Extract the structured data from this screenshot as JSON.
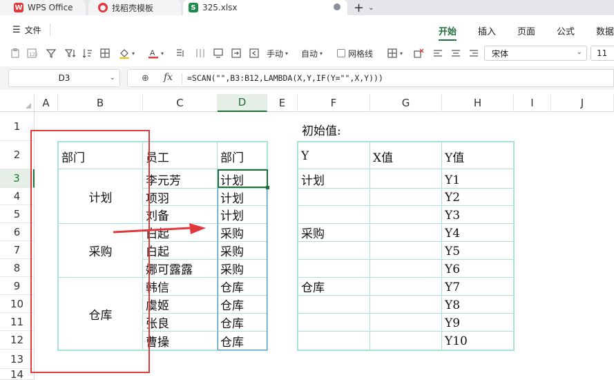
{
  "tabs": [
    {
      "label": "WPS Office",
      "icon": "wps-logo-icon",
      "color": "#e0393b"
    },
    {
      "label": "找稻壳模板",
      "icon": "daoke-logo-icon",
      "color": "#e0393b"
    },
    {
      "label": "325.xlsx",
      "icon": "sheet-logo-icon",
      "color": "#1f8a4c"
    }
  ],
  "menu": {
    "file": "文件",
    "ribbon_tabs": [
      "开始",
      "插入",
      "页面",
      "公式",
      "数据"
    ],
    "active": "开始"
  },
  "toolbar": {
    "fill_label": "手动",
    "auto_label": "自动",
    "gridlines_label": "网格线",
    "font_name": "宋体",
    "font_size": "11",
    "accent_color": "#1f6f3a",
    "highlight_color": "#f2c200",
    "font_color": "#e0393b"
  },
  "formula_bar": {
    "name_box": "D3",
    "fx": "fx",
    "formula": "=SCAN(\"\",B3:B12,LAMBDA(X,Y,IF(Y=\"\",X,Y)))"
  },
  "columns": [
    "A",
    "B",
    "C",
    "D",
    "E",
    "F",
    "G",
    "H",
    "I",
    "J"
  ],
  "rows": [
    "1",
    "2",
    "3",
    "4",
    "5",
    "6",
    "7",
    "8",
    "9",
    "10",
    "11",
    "12",
    "13",
    "14"
  ],
  "selected": {
    "column": "D",
    "row": "3"
  },
  "sheet": {
    "initial_title": "初始值:",
    "left_headers": {
      "dept": "部门",
      "staff": "员工",
      "result": "部门"
    },
    "merged_depts": [
      "计划",
      "采购",
      "仓库"
    ],
    "staff": [
      "李元芳",
      "项羽",
      "刘备",
      "白起",
      "白起",
      "娜可露露",
      "韩信",
      "虞姬",
      "张良",
      "曹操"
    ],
    "result": [
      "计划",
      "计划",
      "计划",
      "采购",
      "采购",
      "采购",
      "仓库",
      "仓库",
      "仓库",
      "仓库"
    ],
    "right_headers": {
      "y": "Y",
      "x": "X值",
      "yv": "Y值"
    },
    "y_values": [
      "计划",
      "",
      "",
      "采购",
      "",
      "",
      "仓库",
      "",
      "",
      ""
    ],
    "yv_values": [
      "Y1",
      "Y2",
      "Y3",
      "Y4",
      "Y5",
      "Y6",
      "Y7",
      "Y8",
      "Y9",
      "Y10"
    ]
  },
  "annotation_color": "#e0393b"
}
